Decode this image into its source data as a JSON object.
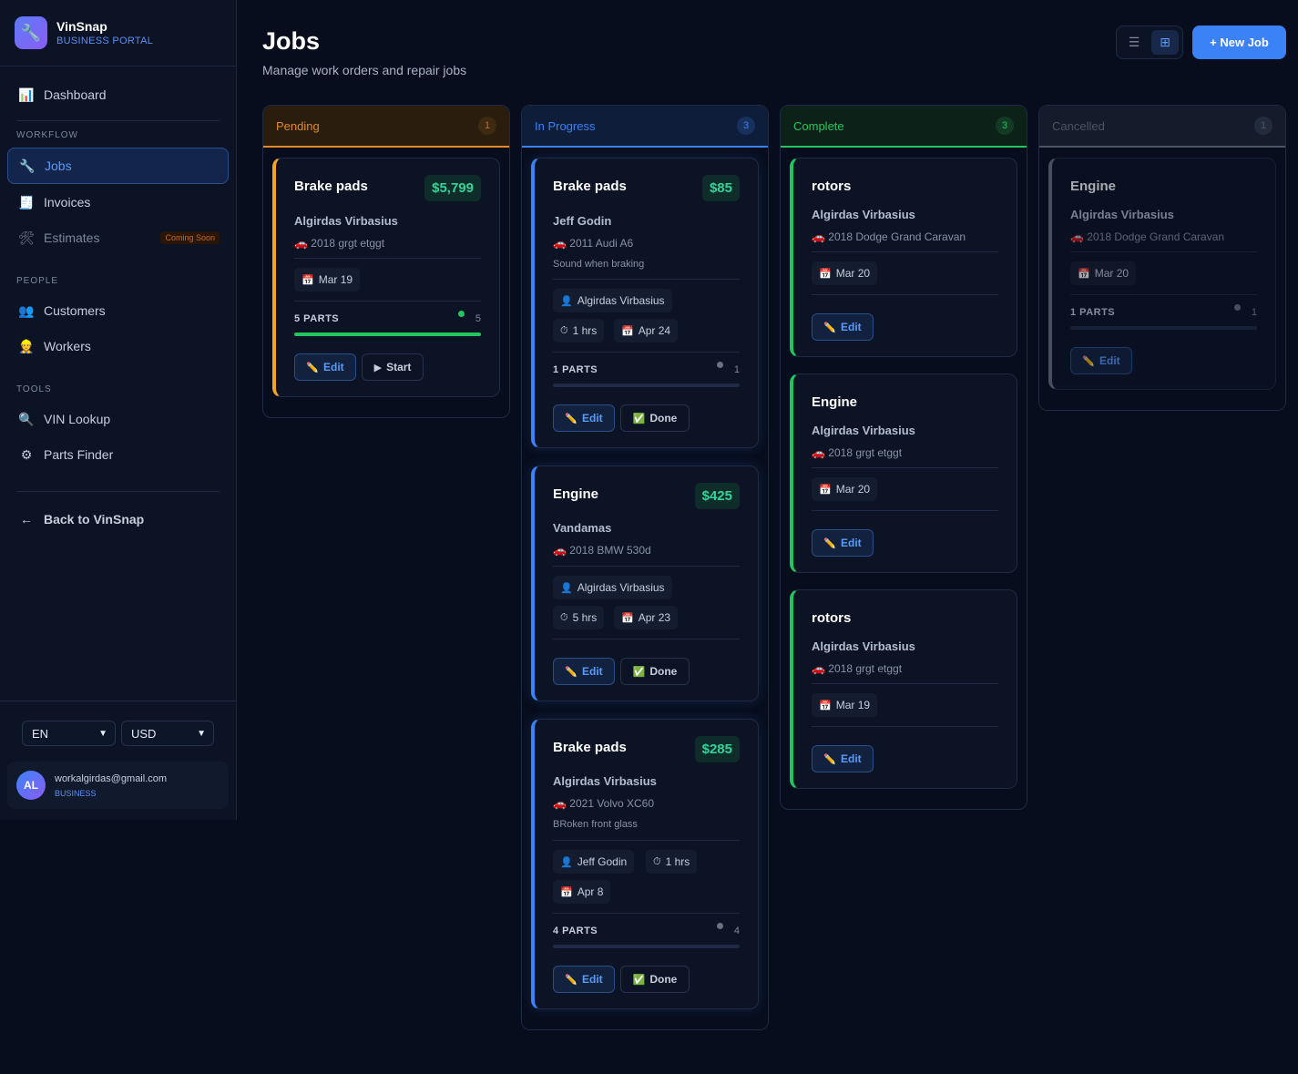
{
  "brand": {
    "name": "VinSnap",
    "subtitle": "BUSINESS PORTAL"
  },
  "nav": {
    "dashboard": "Dashboard",
    "workflow_section": "WORKFLOW",
    "jobs": "Jobs",
    "invoices": "Invoices",
    "estimates": "Estimates",
    "coming_soon": "Coming Soon",
    "people_section": "PEOPLE",
    "customers": "Customers",
    "workers": "Workers",
    "tools_section": "TOOLS",
    "vin_lookup": "VIN Lookup",
    "parts_finder": "Parts Finder",
    "back": "Back to VinSnap"
  },
  "settings": {
    "language": "EN",
    "currency": "USD"
  },
  "user": {
    "initials": "AL",
    "email": "workalgirdas@gmail.com",
    "role": "BUSINESS"
  },
  "header": {
    "title": "Jobs",
    "subtitle": "Manage work orders and repair jobs",
    "new_job": "+ New Job"
  },
  "columns": [
    {
      "name": "Pending",
      "count": "1",
      "color": "#e08a2c"
    },
    {
      "name": "In Progress",
      "count": "3",
      "color": "#3b82f6"
    },
    {
      "name": "Complete",
      "count": "3",
      "color": "#22c55e"
    },
    {
      "name": "Cancelled",
      "count": "1",
      "color": "#6b7280"
    }
  ],
  "labels": {
    "edit": "Edit",
    "start": "Start",
    "done": "Done"
  },
  "jobs": {
    "pending": [
      {
        "title": "Brake pads",
        "price": "$5,799",
        "customer": "Algirdas Virbasius",
        "vehicle": "2018 grgt etggt",
        "date": "Mar 19",
        "parts": "5 PARTS",
        "parts_count": "5",
        "progress": 1.0
      }
    ],
    "in_progress": [
      {
        "title": "Brake pads",
        "price": "$85",
        "customer": "Jeff Godin",
        "vehicle": "2011 Audi A6",
        "note": "Sound when braking",
        "worker": "Algirdas Virbasius",
        "hours": "1 hrs",
        "date": "Apr 24",
        "parts": "1 PARTS",
        "parts_count": "1",
        "progress": 0
      },
      {
        "title": "Engine",
        "price": "$425",
        "customer": "Vandamas",
        "vehicle": "2018 BMW 530d",
        "worker": "Algirdas Virbasius",
        "hours": "5 hrs",
        "date": "Apr 23"
      },
      {
        "title": "Brake pads",
        "price": "$285",
        "customer": "Algirdas Virbasius",
        "vehicle": "2021 Volvo XC60",
        "note": "BRoken front glass",
        "worker": "Jeff Godin",
        "hours": "1 hrs",
        "date": "Apr 8",
        "parts": "4 PARTS",
        "parts_count": "4",
        "progress": 0
      }
    ],
    "complete": [
      {
        "title": "rotors",
        "customer": "Algirdas Virbasius",
        "vehicle": "2018 Dodge Grand Caravan",
        "date": "Mar 20"
      },
      {
        "title": "Engine",
        "customer": "Algirdas Virbasius",
        "vehicle": "2018 grgt etggt",
        "date": "Mar 20"
      },
      {
        "title": "rotors",
        "customer": "Algirdas Virbasius",
        "vehicle": "2018 grgt etggt",
        "date": "Mar 19"
      }
    ],
    "cancelled": [
      {
        "title": "Engine",
        "customer": "Algirdas Virbasius",
        "vehicle": "2018 Dodge Grand Caravan",
        "date": "Mar 20",
        "parts": "1 PARTS",
        "parts_count": "1",
        "progress": 0
      }
    ]
  },
  "icons": {
    "logo": "wrench-icon",
    "dashboard": "chart-icon",
    "jobs": "wrench-icon",
    "invoices": "receipt-icon",
    "estimates": "tools-icon",
    "customers": "people-icon",
    "workers": "worker-icon",
    "vin": "magnifier-icon",
    "parts": "gear-icon",
    "back": "arrow-left-icon",
    "vehicle": "car-icon",
    "calendar": "calendar-icon",
    "clock": "stopwatch-icon",
    "person": "person-icon",
    "edit": "pencil-icon",
    "start": "play-icon",
    "done": "check-icon",
    "list_view": "list-icon",
    "grid_view": "grid-icon"
  }
}
